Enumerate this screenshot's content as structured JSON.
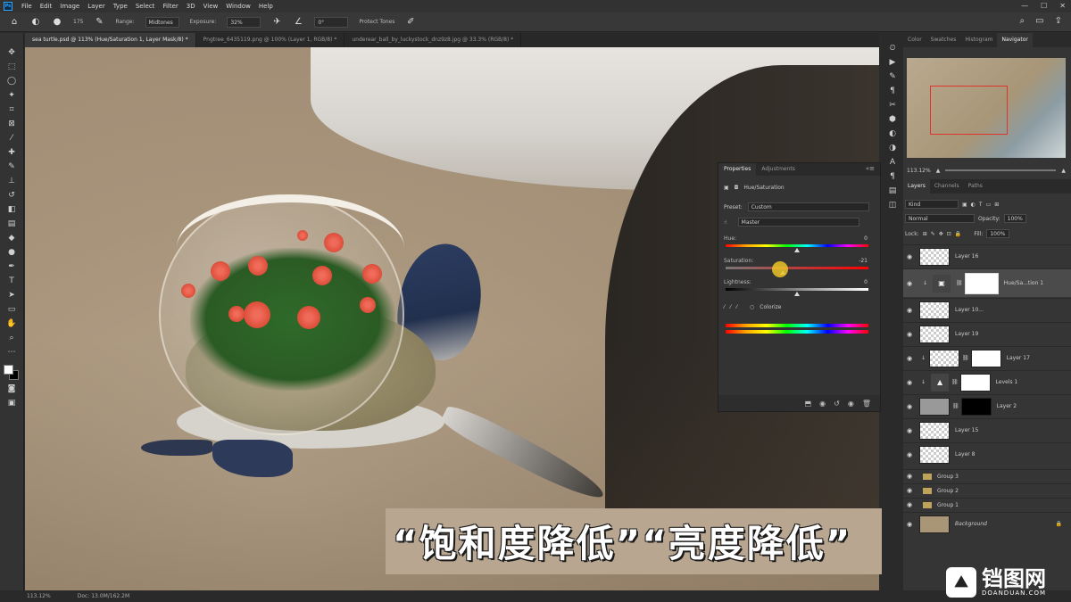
{
  "menubar": {
    "logo": "Ps",
    "items": [
      "File",
      "Edit",
      "Image",
      "Layer",
      "Type",
      "Select",
      "Filter",
      "3D",
      "View",
      "Window",
      "Help"
    ]
  },
  "options": {
    "brush_size": "175",
    "range_label": "Range:",
    "range_value": "Midtones",
    "exposure_label": "Exposure:",
    "exposure_value": "32%",
    "angle_value": "0°",
    "protect_tones": "Protect Tones"
  },
  "tabs": [
    "sea turtle.psd @ 113% (Hue/Saturation 1, Layer Mask/8) *",
    "Pngtree_6435119.png @ 100% (Layer 1, RGB/8) *",
    "underear_ball_by_luckystock_dnz9z8.jpg @ 33.3% (RGB/8) *"
  ],
  "subtitle": "“饱和度降低”“亮度降低”",
  "properties": {
    "tab_properties": "Properties",
    "tab_adjustments": "Adjustments",
    "adjustment_name": "Hue/Saturation",
    "preset_label": "Preset:",
    "preset_value": "Custom",
    "channel_value": "Master",
    "hue_label": "Hue:",
    "hue_value": "0",
    "saturation_label": "Saturation:",
    "saturation_value": "-21",
    "lightness_label": "Lightness:",
    "lightness_value": "0",
    "colorize_label": "Colorize"
  },
  "right_tabs": [
    "Color",
    "Swatches",
    "Histogram",
    "Navigator"
  ],
  "navigator": {
    "zoom": "113.12%"
  },
  "layers_panel": {
    "tabs": [
      "Layers",
      "Channels",
      "Paths"
    ],
    "kind_label": "Kind",
    "blend_mode": "Normal",
    "opacity_label": "Opacity:",
    "opacity_value": "100%",
    "lock_label": "Lock:",
    "fill_label": "Fill:",
    "fill_value": "100%",
    "layers": [
      {
        "name": "Layer 16",
        "type": "pixel"
      },
      {
        "name": "Hue/Sa...tion 1",
        "type": "adjustment"
      },
      {
        "name": "Layer 10...",
        "type": "pixel"
      },
      {
        "name": "Layer 19",
        "type": "pixel"
      },
      {
        "name": "Layer 17",
        "type": "pixel-mask"
      },
      {
        "name": "Levels 1",
        "type": "levels-mask"
      },
      {
        "name": "Layer 2",
        "type": "pixel-darkmask"
      },
      {
        "name": "Layer 15",
        "type": "pixel"
      },
      {
        "name": "Layer 8",
        "type": "pixel"
      }
    ],
    "groups": [
      "Group 3",
      "Group 2",
      "Group 1"
    ],
    "background": "Background"
  },
  "status": {
    "zoom": "113.12%",
    "doc": "Doc: 13.0M/162.2M"
  },
  "watermark": {
    "brand": "铛图网",
    "url": "DOANDUAN.COM"
  }
}
